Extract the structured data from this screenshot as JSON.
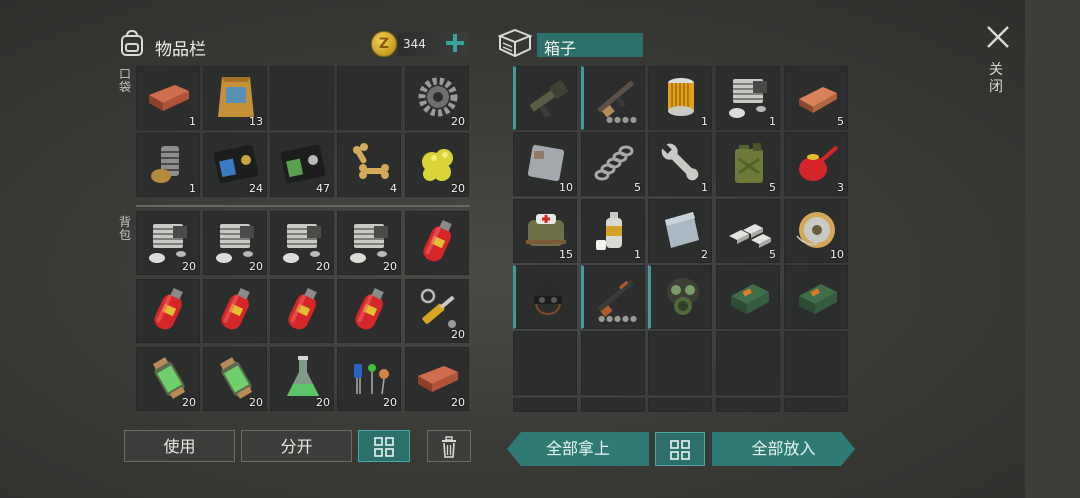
{
  "inventory": {
    "title": "物品栏",
    "coins": "344",
    "pockets_label": "口袋",
    "backpack_label": "背包",
    "pockets": [
      {
        "icon": "brick-icon",
        "count": "1"
      },
      {
        "icon": "seed-bag-icon",
        "count": "13"
      },
      {
        "icon": "empty-slot",
        "count": ""
      },
      {
        "icon": "empty-slot",
        "count": ""
      },
      {
        "icon": "gear-icon",
        "count": "20"
      },
      {
        "icon": "spring-coupling-icon",
        "count": "1"
      },
      {
        "icon": "blue-id-card-icon",
        "count": "24"
      },
      {
        "icon": "green-id-card-icon",
        "count": "47"
      },
      {
        "icon": "dog-bone-icon",
        "count": "4"
      },
      {
        "icon": "sulfur-icon",
        "count": "20"
      }
    ],
    "backpack": [
      {
        "icon": "engine-part-icon",
        "count": "20"
      },
      {
        "icon": "engine-part-icon",
        "count": "20"
      },
      {
        "icon": "engine-part-icon",
        "count": "20"
      },
      {
        "icon": "engine-part-icon",
        "count": "20"
      },
      {
        "icon": "gas-cylinder-icon",
        "count": ""
      },
      {
        "icon": "gas-cylinder-icon",
        "count": ""
      },
      {
        "icon": "gas-cylinder-icon",
        "count": ""
      },
      {
        "icon": "gas-cylinder-icon",
        "count": ""
      },
      {
        "icon": "gas-cylinder-icon",
        "count": ""
      },
      {
        "icon": "hydraulic-piston-icon",
        "count": "20"
      },
      {
        "icon": "chemical-flask-icon",
        "count": "20"
      },
      {
        "icon": "chemical-flask-icon",
        "count": "20"
      },
      {
        "icon": "erlenmeyer-flask-icon",
        "count": "20"
      },
      {
        "icon": "electronic-components-icon",
        "count": "20"
      },
      {
        "icon": "brick-icon",
        "count": "20"
      }
    ],
    "buttons": {
      "use": "使用",
      "split": "分开"
    }
  },
  "box": {
    "title": "箱子",
    "items": [
      {
        "icon": "grenade-launcher-icon",
        "count": "",
        "equip": true
      },
      {
        "icon": "assault-rifle-icon",
        "count": "",
        "equip": true,
        "dur": "●●●●"
      },
      {
        "icon": "filter-cartridge-icon",
        "count": "1"
      },
      {
        "icon": "engine-part-icon",
        "count": "1"
      },
      {
        "icon": "copper-ingot-icon",
        "count": "5"
      },
      {
        "icon": "metal-plate-icon",
        "count": "10"
      },
      {
        "icon": "coil-spring-icon",
        "count": "5"
      },
      {
        "icon": "wrench-icon",
        "count": "1"
      },
      {
        "icon": "jerrycan-icon",
        "count": "5"
      },
      {
        "icon": "oil-can-icon",
        "count": "3"
      },
      {
        "icon": "medkit-bag-icon",
        "count": "15"
      },
      {
        "icon": "spray-can-icon",
        "count": "1"
      },
      {
        "icon": "steel-plate-icon",
        "count": "2"
      },
      {
        "icon": "aluminum-bars-icon",
        "count": "5"
      },
      {
        "icon": "wire-spool-icon",
        "count": "10"
      },
      {
        "icon": "combat-helmet-icon",
        "count": "",
        "equip": true
      },
      {
        "icon": "ak-rifle-icon",
        "count": "",
        "equip": true,
        "dur": "●●●●●"
      },
      {
        "icon": "gas-mask-icon",
        "count": "",
        "equip": true
      },
      {
        "icon": "ammo-box-icon",
        "count": ""
      },
      {
        "icon": "ammo-box-icon",
        "count": ""
      }
    ],
    "buttons": {
      "take_all": "全部拿上",
      "put_all": "全部放入"
    }
  },
  "close_label": "关闭",
  "colors": {
    "teal": "#2d6f6b",
    "accent": "#3f9c98",
    "gold": "#d2a629"
  }
}
